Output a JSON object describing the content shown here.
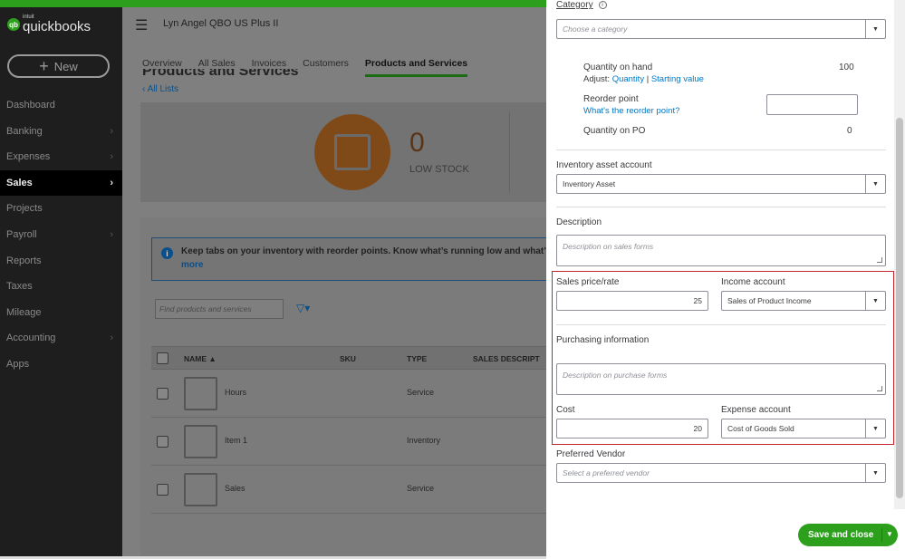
{
  "brand": {
    "intuit": "intuit",
    "name": "quickbooks",
    "badge": "qb"
  },
  "nav": {
    "new_label": "New",
    "items": [
      {
        "label": "Dashboard",
        "chevron": ""
      },
      {
        "label": "Banking",
        "chevron": "›"
      },
      {
        "label": "Expenses",
        "chevron": "›"
      },
      {
        "label": "Sales",
        "chevron": "›",
        "active": true
      },
      {
        "label": "Projects",
        "chevron": ""
      },
      {
        "label": "Payroll",
        "chevron": "›"
      },
      {
        "label": "Reports",
        "chevron": ""
      },
      {
        "label": "Taxes",
        "chevron": ""
      },
      {
        "label": "Mileage",
        "chevron": ""
      },
      {
        "label": "Accounting",
        "chevron": "›"
      },
      {
        "label": "Apps",
        "chevron": ""
      }
    ]
  },
  "header": {
    "company": "Lyn Angel QBO US Plus II"
  },
  "tabs": [
    "Overview",
    "All Sales",
    "Invoices",
    "Customers",
    "Products and Services"
  ],
  "page": {
    "title": "Products and Services",
    "all_lists": "All Lists",
    "stock_count": "0",
    "stock_label": "LOW STOCK",
    "info_text": "Keep tabs on your inventory with reorder points. Know what’s running low and what’s o",
    "info_more": "more",
    "search_placeholder": "Find products and services"
  },
  "table": {
    "headers": [
      "NAME ▲",
      "SKU",
      "TYPE",
      "SALES DESCRIPT"
    ],
    "rows": [
      {
        "name": "Hours",
        "sku": "",
        "type": "Service"
      },
      {
        "name": "Item 1",
        "sku": "",
        "type": "Inventory"
      },
      {
        "name": "Sales",
        "sku": "",
        "type": "Service"
      }
    ]
  },
  "drawer": {
    "category_label": "Category",
    "category_placeholder": "Choose a category",
    "qoh_label": "Quantity on hand",
    "qoh_value": "100",
    "adjust_label": "Adjust:",
    "adjust_quantity": "Quantity",
    "adjust_sep": "|",
    "adjust_starting": "Starting value",
    "reorder_label": "Reorder point",
    "reorder_link": "What's the reorder point?",
    "reorder_value": "",
    "qpo_label": "Quantity on PO",
    "qpo_value": "0",
    "asset_label": "Inventory asset account",
    "asset_value": "Inventory Asset",
    "description_label": "Description",
    "description_placeholder": "Description on sales forms",
    "price_label": "Sales price/rate",
    "price_value": "25",
    "income_label": "Income account",
    "income_value": "Sales of Product Income",
    "purchasing_label": "Purchasing information",
    "purchase_placeholder": "Description on purchase forms",
    "cost_label": "Cost",
    "cost_value": "20",
    "expense_label": "Expense account",
    "expense_value": "Cost of Goods Sold",
    "vendor_label": "Preferred Vendor",
    "vendor_placeholder": "Select a preferred vendor",
    "save_label": "Save and close"
  },
  "colors": {
    "brand_green": "#2ca01c",
    "link_blue": "#0077c5",
    "highlight_red": "#c1272d"
  }
}
